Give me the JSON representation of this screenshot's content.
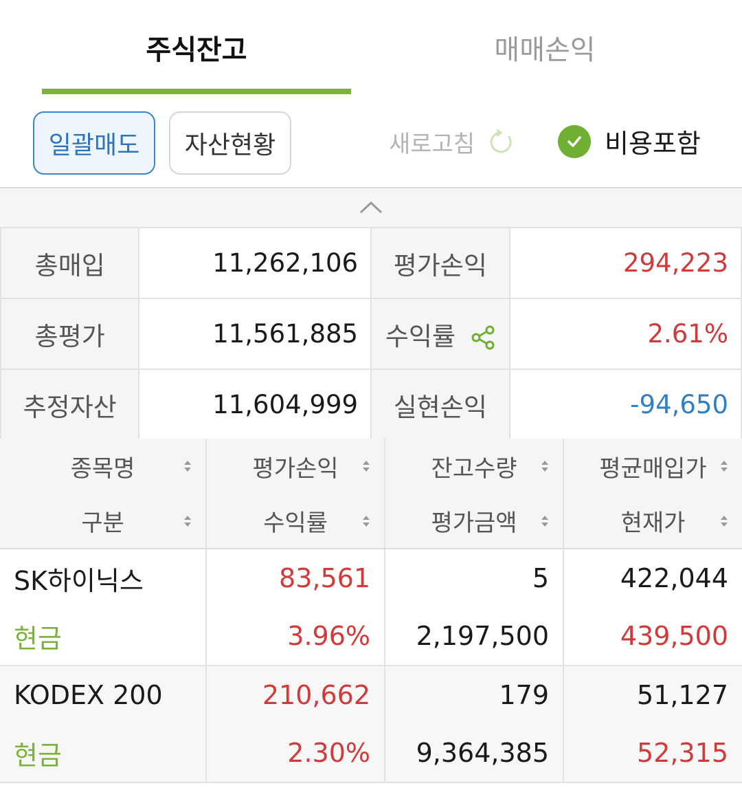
{
  "tabs": {
    "active": "주식잔고",
    "inactive": "매매손익"
  },
  "actions": {
    "sell_all": "일괄매도",
    "assets": "자산현황",
    "refresh": "새로고침",
    "include_fees": "비용포함"
  },
  "summary": {
    "total_buy_label": "총매입",
    "total_buy": "11,262,106",
    "eval_pl_label": "평가손익",
    "eval_pl": "294,223",
    "total_eval_label": "총평가",
    "total_eval": "11,561,885",
    "return_label": "수익률",
    "return": "2.61%",
    "est_assets_label": "추정자산",
    "est_assets": "11,604,999",
    "realized_label": "실현손익",
    "realized": "-94,650"
  },
  "table": {
    "headers": {
      "name": "종목명",
      "eval_pl": "평가손익",
      "qty": "잔고수량",
      "avg_price": "평균매입가",
      "type": "구분",
      "return": "수익률",
      "eval_amt": "평가금액",
      "cur_price": "현재가"
    },
    "rows": [
      {
        "name": "SK하이닉스",
        "eval_pl": "83,561",
        "qty": "5",
        "avg_price": "422,044",
        "type": "현금",
        "return": "3.96%",
        "eval_amt": "2,197,500",
        "cur_price": "439,500"
      },
      {
        "name": "KODEX 200",
        "eval_pl": "210,662",
        "qty": "179",
        "avg_price": "51,127",
        "type": "현금",
        "return": "2.30%",
        "eval_amt": "9,364,385",
        "cur_price": "52,315"
      }
    ]
  },
  "colors": {
    "accent": "#7bb33a",
    "profit": "#d23a3a",
    "loss": "#2f7fc4",
    "primary_button": "#3a86c8"
  },
  "icons": [
    "refresh-icon",
    "check-icon",
    "share-icon",
    "chevron-up-icon",
    "sort-icon"
  ]
}
